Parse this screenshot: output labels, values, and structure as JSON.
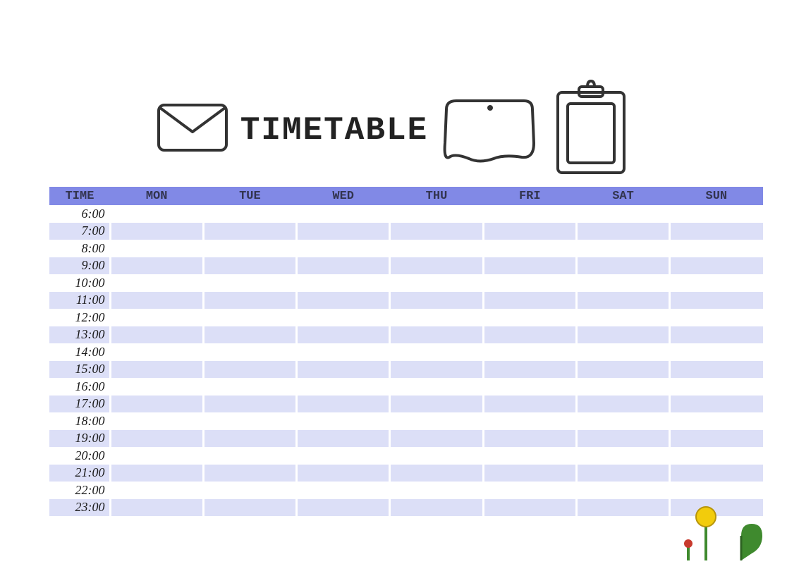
{
  "title": "TIMETABLE",
  "colors": {
    "header_bg": "#8189e6",
    "row_alt_bg": "#dcdff7",
    "accent_yellow": "#f2cc0c",
    "accent_green": "#3f8a2e",
    "accent_red": "#c83a2d"
  },
  "columns": {
    "time": "TIME",
    "days": [
      "MON",
      "TUE",
      "WED",
      "THU",
      "FRI",
      "SAT",
      "SUN"
    ]
  },
  "rows": [
    {
      "time": "6:00",
      "cells": [
        "",
        "",
        "",
        "",
        "",
        "",
        ""
      ]
    },
    {
      "time": "7:00",
      "cells": [
        "",
        "",
        "",
        "",
        "",
        "",
        ""
      ]
    },
    {
      "time": "8:00",
      "cells": [
        "",
        "",
        "",
        "",
        "",
        "",
        ""
      ]
    },
    {
      "time": "9:00",
      "cells": [
        "",
        "",
        "",
        "",
        "",
        "",
        ""
      ]
    },
    {
      "time": "10:00",
      "cells": [
        "",
        "",
        "",
        "",
        "",
        "",
        ""
      ]
    },
    {
      "time": "11:00",
      "cells": [
        "",
        "",
        "",
        "",
        "",
        "",
        ""
      ]
    },
    {
      "time": "12:00",
      "cells": [
        "",
        "",
        "",
        "",
        "",
        "",
        ""
      ]
    },
    {
      "time": "13:00",
      "cells": [
        "",
        "",
        "",
        "",
        "",
        "",
        ""
      ]
    },
    {
      "time": "14:00",
      "cells": [
        "",
        "",
        "",
        "",
        "",
        "",
        ""
      ]
    },
    {
      "time": "15:00",
      "cells": [
        "",
        "",
        "",
        "",
        "",
        "",
        ""
      ]
    },
    {
      "time": "16:00",
      "cells": [
        "",
        "",
        "",
        "",
        "",
        "",
        ""
      ]
    },
    {
      "time": "17:00",
      "cells": [
        "",
        "",
        "",
        "",
        "",
        "",
        ""
      ]
    },
    {
      "time": "18:00",
      "cells": [
        "",
        "",
        "",
        "",
        "",
        "",
        ""
      ]
    },
    {
      "time": "19:00",
      "cells": [
        "",
        "",
        "",
        "",
        "",
        "",
        ""
      ]
    },
    {
      "time": "20:00",
      "cells": [
        "",
        "",
        "",
        "",
        "",
        "",
        ""
      ]
    },
    {
      "time": "21:00",
      "cells": [
        "",
        "",
        "",
        "",
        "",
        "",
        ""
      ]
    },
    {
      "time": "22:00",
      "cells": [
        "",
        "",
        "",
        "",
        "",
        "",
        ""
      ]
    },
    {
      "time": "23:00",
      "cells": [
        "",
        "",
        "",
        "",
        "",
        "",
        ""
      ]
    }
  ]
}
